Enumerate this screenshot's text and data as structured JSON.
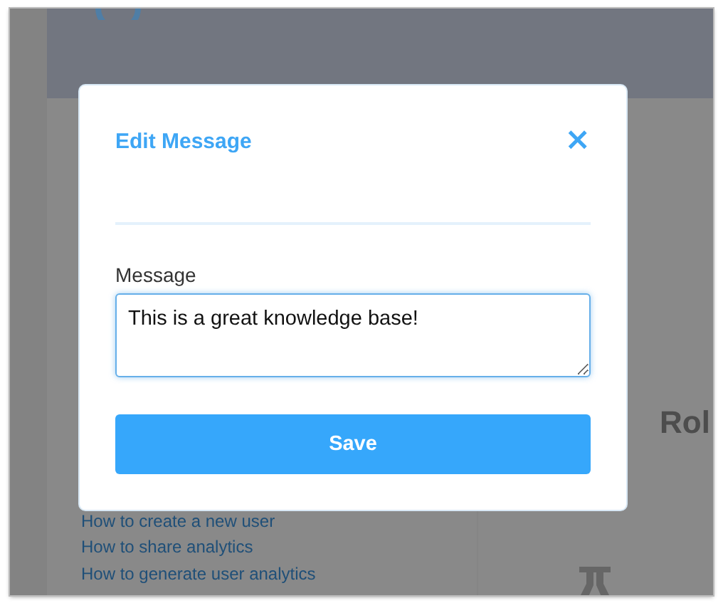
{
  "background": {
    "heading": "Rol",
    "links": [
      "How to create a new user",
      "How to share analytics",
      "How to generate user analytics"
    ]
  },
  "modal": {
    "title": "Edit Message",
    "close": "×",
    "field": {
      "label": "Message",
      "value": "This is a great knowledge base!"
    },
    "button": "Save"
  }
}
